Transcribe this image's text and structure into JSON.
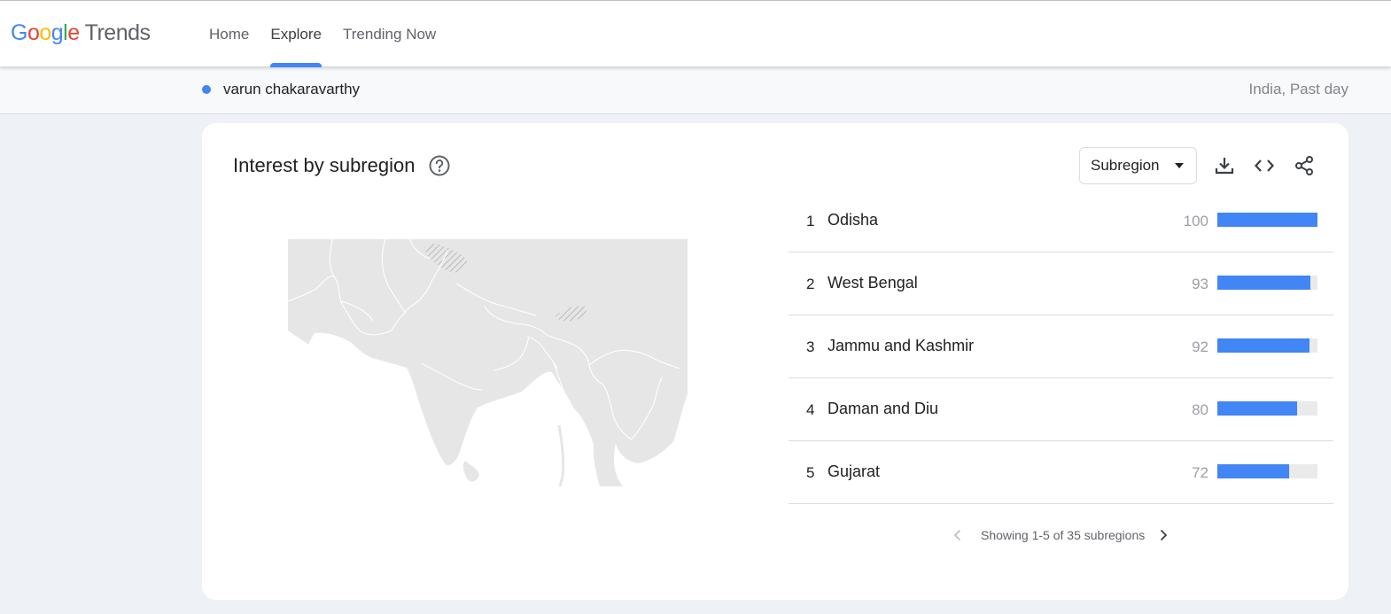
{
  "app": {
    "logo_letters": [
      "G",
      "o",
      "o",
      "g",
      "l",
      "e"
    ],
    "logo_product": "Trends"
  },
  "nav": {
    "tabs": [
      {
        "label": "Home",
        "active": false
      },
      {
        "label": "Explore",
        "active": true
      },
      {
        "label": "Trending Now",
        "active": false
      }
    ]
  },
  "search": {
    "term": "varun chakaravarthy",
    "term_color": "#4285f4",
    "filters": "India, Past day"
  },
  "card": {
    "title": "Interest by subregion",
    "help_icon": "help-circle-icon",
    "resolution": "Subregion",
    "actions": [
      "download-icon",
      "embed-code-icon",
      "share-icon"
    ]
  },
  "ranking": {
    "items": [
      {
        "rank": "1",
        "name": "Odisha",
        "value": 100
      },
      {
        "rank": "2",
        "name": "West Bengal",
        "value": 93
      },
      {
        "rank": "3",
        "name": "Jammu and Kashmir",
        "value": 92
      },
      {
        "rank": "4",
        "name": "Daman and Diu",
        "value": 80
      },
      {
        "rank": "5",
        "name": "Gujarat",
        "value": 72
      }
    ],
    "bar_color": "#4285f4",
    "pagination": "Showing 1-5 of 35 subregions"
  }
}
